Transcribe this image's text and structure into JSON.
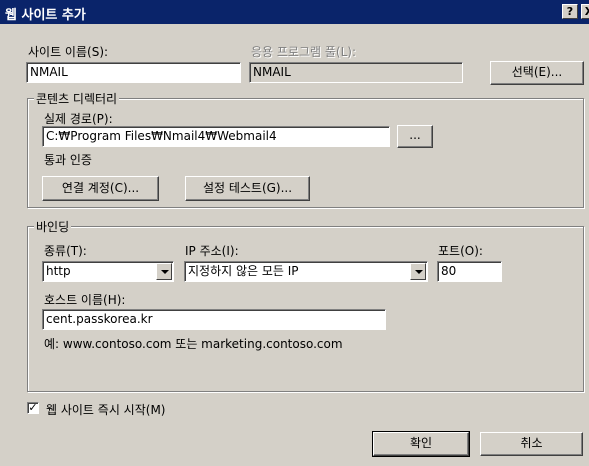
{
  "window": {
    "title": "웹 사이트 추가",
    "help_btn": "?",
    "close_btn": "X"
  },
  "site_name": {
    "label": "사이트 이름(S):",
    "value": "NMAIL"
  },
  "app_pool": {
    "label": "응용 프로그램 풀(L):",
    "value": "NMAIL",
    "select_button": "선택(E)..."
  },
  "content_dir": {
    "legend": "콘텐츠 디렉터리",
    "physical_path_label": "실제 경로(P):",
    "physical_path_value": "C:₩Program Files₩Nmail4₩Webmail4",
    "browse_button": "...",
    "pass_through_label": "통과 인증",
    "connect_as_button": "연결 계정(C)...",
    "test_settings_button": "설정 테스트(G)..."
  },
  "binding": {
    "legend": "바인딩",
    "type_label": "종류(T):",
    "type_value": "http",
    "ip_label": "IP 주소(I):",
    "ip_value": "지정하지 않은 모든 IP",
    "port_label": "포트(O):",
    "port_value": "80",
    "host_label": "호스트 이름(H):",
    "host_value": "cent.passkorea.kr",
    "example_text": "예: www.contoso.com 또는 marketing.contoso.com"
  },
  "start_immediately": {
    "label": "웹 사이트 즉시 시작(M)",
    "checked": "✓"
  },
  "footer": {
    "ok_button": "확인",
    "cancel_button": "취소"
  }
}
